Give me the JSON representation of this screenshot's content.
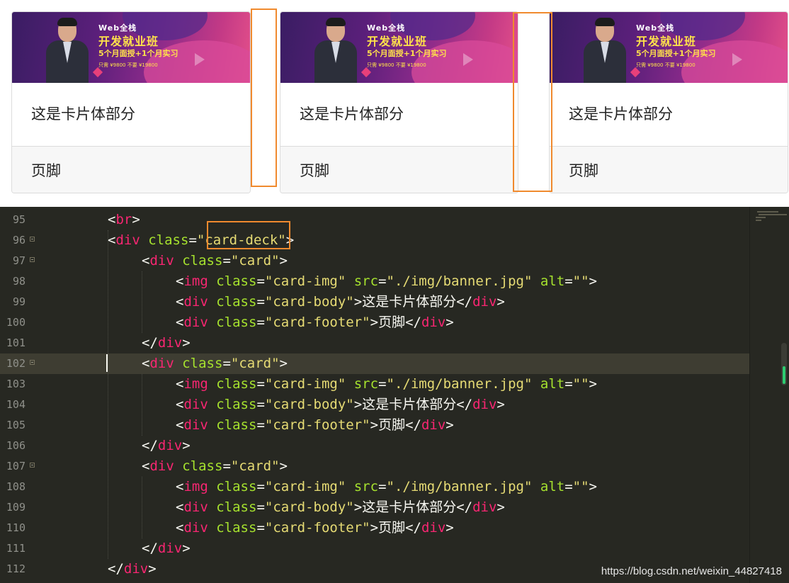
{
  "preview": {
    "cards": [
      {
        "banner": {
          "line1": "Web全栈",
          "line2": "开发就业班",
          "line3": "5个月面授+1个月实习",
          "line4": "只需 ¥9800  不要 ¥19800"
        },
        "body": "这是卡片体部分",
        "footer": "页脚"
      },
      {
        "banner": {
          "line1": "Web全栈",
          "line2": "开发就业班",
          "line3": "5个月面授+1个月实习",
          "line4": "只需 ¥9800  不要 ¥19800"
        },
        "body": "这是卡片体部分",
        "footer": "页脚"
      },
      {
        "banner": {
          "line1": "Web全栈",
          "line2": "开发就业班",
          "line3": "5个月面授+1个月实习",
          "line4": "只需 ¥9800  不要 ¥19800"
        },
        "body": "这是卡片体部分",
        "footer": "页脚"
      }
    ],
    "highlight_color": "#f08a2e"
  },
  "editor": {
    "theme": {
      "background": "#272822",
      "tag": "#f92672",
      "attr": "#a6e22e",
      "string": "#e6db74",
      "text": "#f8f8f2",
      "line_number": "#8f908a"
    },
    "active_line": "102",
    "lines": [
      {
        "num": "95",
        "fold": false,
        "parts": [
          [
            "p",
            "<"
          ],
          [
            "t",
            "br"
          ],
          [
            "p",
            ">"
          ]
        ]
      },
      {
        "num": "96",
        "fold": true,
        "parts": [
          [
            "p",
            "<"
          ],
          [
            "t",
            "div"
          ],
          [
            "p",
            " "
          ],
          [
            "a",
            "class"
          ],
          [
            "p",
            "="
          ],
          [
            "s",
            "\"card-deck\""
          ],
          [
            "p",
            ">"
          ]
        ]
      },
      {
        "num": "97",
        "fold": true,
        "parts": [
          [
            "p",
            "<"
          ],
          [
            "t",
            "div"
          ],
          [
            "p",
            " "
          ],
          [
            "a",
            "class"
          ],
          [
            "p",
            "="
          ],
          [
            "s",
            "\"card\""
          ],
          [
            "p",
            ">"
          ]
        ]
      },
      {
        "num": "98",
        "fold": false,
        "parts": [
          [
            "p",
            "<"
          ],
          [
            "t",
            "img"
          ],
          [
            "p",
            " "
          ],
          [
            "a",
            "class"
          ],
          [
            "p",
            "="
          ],
          [
            "s",
            "\"card-img\""
          ],
          [
            "p",
            " "
          ],
          [
            "a",
            "src"
          ],
          [
            "p",
            "="
          ],
          [
            "s",
            "\"./img/banner.jpg\""
          ],
          [
            "p",
            " "
          ],
          [
            "a",
            "alt"
          ],
          [
            "p",
            "="
          ],
          [
            "s",
            "\"\""
          ],
          [
            "p",
            ">"
          ]
        ]
      },
      {
        "num": "99",
        "fold": false,
        "parts": [
          [
            "p",
            "<"
          ],
          [
            "t",
            "div"
          ],
          [
            "p",
            " "
          ],
          [
            "a",
            "class"
          ],
          [
            "p",
            "="
          ],
          [
            "s",
            "\"card-body\""
          ],
          [
            "p",
            ">"
          ],
          [
            "x",
            "这是卡片体部分"
          ],
          [
            "p",
            "</"
          ],
          [
            "t",
            "div"
          ],
          [
            "p",
            ">"
          ]
        ]
      },
      {
        "num": "100",
        "fold": false,
        "parts": [
          [
            "p",
            "<"
          ],
          [
            "t",
            "div"
          ],
          [
            "p",
            " "
          ],
          [
            "a",
            "class"
          ],
          [
            "p",
            "="
          ],
          [
            "s",
            "\"card-footer\""
          ],
          [
            "p",
            ">"
          ],
          [
            "x",
            "页脚"
          ],
          [
            "p",
            "</"
          ],
          [
            "t",
            "div"
          ],
          [
            "p",
            ">"
          ]
        ]
      },
      {
        "num": "101",
        "fold": false,
        "parts": [
          [
            "p",
            "</"
          ],
          [
            "t",
            "div"
          ],
          [
            "p",
            ">"
          ]
        ]
      },
      {
        "num": "102",
        "fold": true,
        "parts": [
          [
            "p",
            "<"
          ],
          [
            "t",
            "div"
          ],
          [
            "p",
            " "
          ],
          [
            "a",
            "class"
          ],
          [
            "p",
            "="
          ],
          [
            "s",
            "\"card\""
          ],
          [
            "p",
            ">"
          ]
        ]
      },
      {
        "num": "103",
        "fold": false,
        "parts": [
          [
            "p",
            "<"
          ],
          [
            "t",
            "img"
          ],
          [
            "p",
            " "
          ],
          [
            "a",
            "class"
          ],
          [
            "p",
            "="
          ],
          [
            "s",
            "\"card-img\""
          ],
          [
            "p",
            " "
          ],
          [
            "a",
            "src"
          ],
          [
            "p",
            "="
          ],
          [
            "s",
            "\"./img/banner.jpg\""
          ],
          [
            "p",
            " "
          ],
          [
            "a",
            "alt"
          ],
          [
            "p",
            "="
          ],
          [
            "s",
            "\"\""
          ],
          [
            "p",
            ">"
          ]
        ]
      },
      {
        "num": "104",
        "fold": false,
        "parts": [
          [
            "p",
            "<"
          ],
          [
            "t",
            "div"
          ],
          [
            "p",
            " "
          ],
          [
            "a",
            "class"
          ],
          [
            "p",
            "="
          ],
          [
            "s",
            "\"card-body\""
          ],
          [
            "p",
            ">"
          ],
          [
            "x",
            "这是卡片体部分"
          ],
          [
            "p",
            "</"
          ],
          [
            "t",
            "div"
          ],
          [
            "p",
            ">"
          ]
        ]
      },
      {
        "num": "105",
        "fold": false,
        "parts": [
          [
            "p",
            "<"
          ],
          [
            "t",
            "div"
          ],
          [
            "p",
            " "
          ],
          [
            "a",
            "class"
          ],
          [
            "p",
            "="
          ],
          [
            "s",
            "\"card-footer\""
          ],
          [
            "p",
            ">"
          ],
          [
            "x",
            "页脚"
          ],
          [
            "p",
            "</"
          ],
          [
            "t",
            "div"
          ],
          [
            "p",
            ">"
          ]
        ]
      },
      {
        "num": "106",
        "fold": false,
        "parts": [
          [
            "p",
            "</"
          ],
          [
            "t",
            "div"
          ],
          [
            "p",
            ">"
          ]
        ]
      },
      {
        "num": "107",
        "fold": true,
        "parts": [
          [
            "p",
            "<"
          ],
          [
            "t",
            "div"
          ],
          [
            "p",
            " "
          ],
          [
            "a",
            "class"
          ],
          [
            "p",
            "="
          ],
          [
            "s",
            "\"card\""
          ],
          [
            "p",
            ">"
          ]
        ]
      },
      {
        "num": "108",
        "fold": false,
        "parts": [
          [
            "p",
            "<"
          ],
          [
            "t",
            "img"
          ],
          [
            "p",
            " "
          ],
          [
            "a",
            "class"
          ],
          [
            "p",
            "="
          ],
          [
            "s",
            "\"card-img\""
          ],
          [
            "p",
            " "
          ],
          [
            "a",
            "src"
          ],
          [
            "p",
            "="
          ],
          [
            "s",
            "\"./img/banner.jpg\""
          ],
          [
            "p",
            " "
          ],
          [
            "a",
            "alt"
          ],
          [
            "p",
            "="
          ],
          [
            "s",
            "\"\""
          ],
          [
            "p",
            ">"
          ]
        ]
      },
      {
        "num": "109",
        "fold": false,
        "parts": [
          [
            "p",
            "<"
          ],
          [
            "t",
            "div"
          ],
          [
            "p",
            " "
          ],
          [
            "a",
            "class"
          ],
          [
            "p",
            "="
          ],
          [
            "s",
            "\"card-body\""
          ],
          [
            "p",
            ">"
          ],
          [
            "x",
            "这是卡片体部分"
          ],
          [
            "p",
            "</"
          ],
          [
            "t",
            "div"
          ],
          [
            "p",
            ">"
          ]
        ]
      },
      {
        "num": "110",
        "fold": false,
        "parts": [
          [
            "p",
            "<"
          ],
          [
            "t",
            "div"
          ],
          [
            "p",
            " "
          ],
          [
            "a",
            "class"
          ],
          [
            "p",
            "="
          ],
          [
            "s",
            "\"card-footer\""
          ],
          [
            "p",
            ">"
          ],
          [
            "x",
            "页脚"
          ],
          [
            "p",
            "</"
          ],
          [
            "t",
            "div"
          ],
          [
            "p",
            ">"
          ]
        ]
      },
      {
        "num": "111",
        "fold": false,
        "parts": [
          [
            "p",
            "</"
          ],
          [
            "t",
            "div"
          ],
          [
            "p",
            ">"
          ]
        ]
      },
      {
        "num": "112",
        "fold": false,
        "parts": [
          [
            "p",
            "</"
          ],
          [
            "t",
            "div"
          ],
          [
            "p",
            ">"
          ]
        ]
      }
    ]
  },
  "watermark": "https://blog.csdn.net/weixin_44827418"
}
